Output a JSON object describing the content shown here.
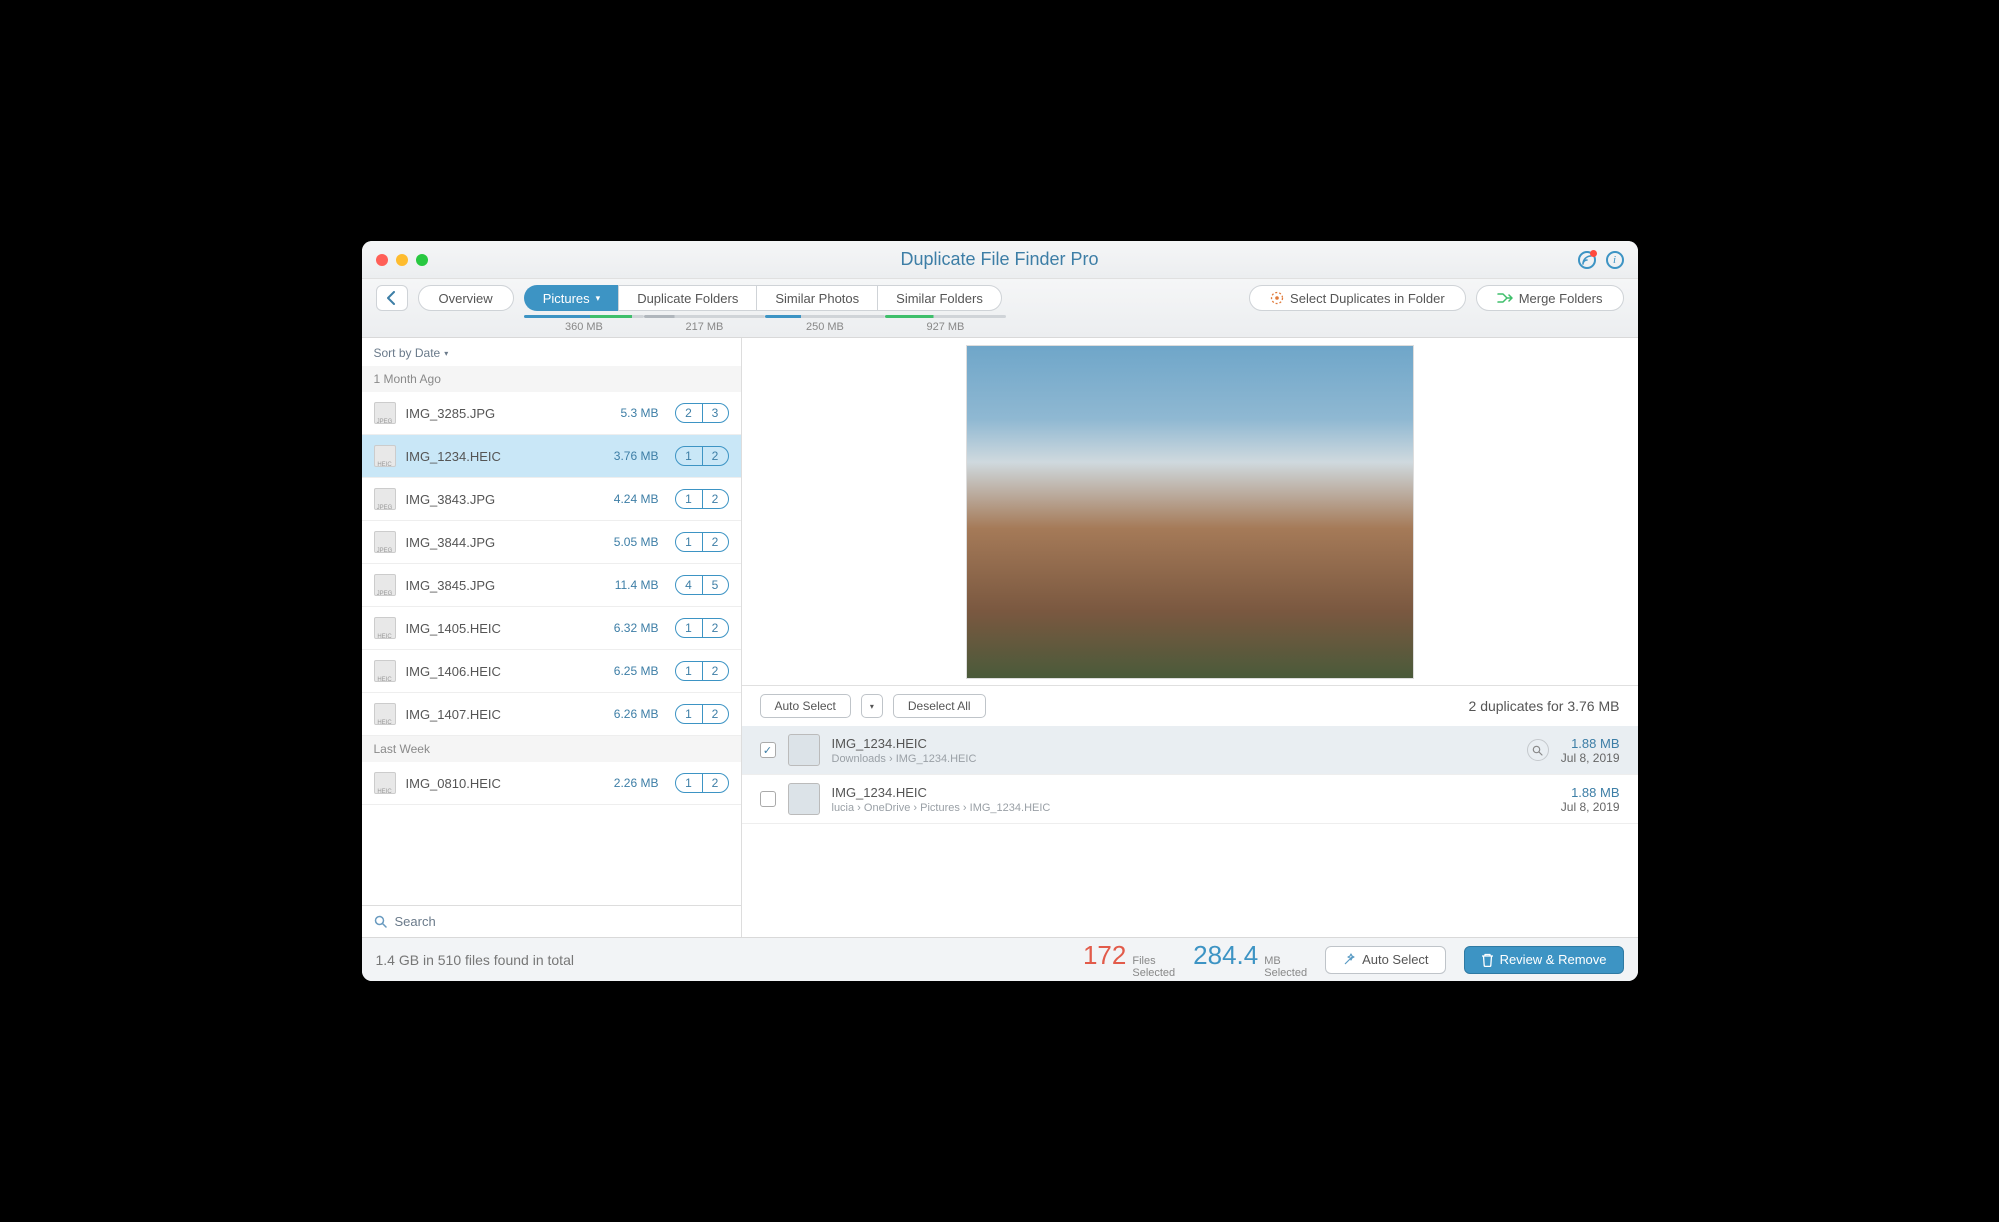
{
  "title": "Duplicate File Finder Pro",
  "toolbar": {
    "overview": "Overview",
    "tabs": [
      {
        "label": "Pictures",
        "size": "360 MB",
        "active": true,
        "bar": {
          "c1": "#3d94c4",
          "p1": 55,
          "c2": "#3fbf6b",
          "p2": 35
        }
      },
      {
        "label": "Duplicate Folders",
        "size": "217 MB",
        "active": false,
        "bar": {
          "c1": "#b0b6bc",
          "p1": 25,
          "c2": "#d0d4d8",
          "p2": 75
        }
      },
      {
        "label": "Similar Photos",
        "size": "250 MB",
        "active": false,
        "bar": {
          "c1": "#3d94c4",
          "p1": 30,
          "c2": "#d0d4d8",
          "p2": 70
        }
      },
      {
        "label": "Similar Folders",
        "size": "927 MB",
        "active": false,
        "bar": {
          "c1": "#3fbf6b",
          "p1": 40,
          "c2": "#d0d4d8",
          "p2": 60
        }
      }
    ],
    "select_in_folder": "Select Duplicates in Folder",
    "merge_folders": "Merge Folders"
  },
  "sidebar": {
    "sort_label": "Sort by Date",
    "groups": [
      {
        "header": "1 Month Ago",
        "items": [
          {
            "name": "IMG_3285.JPG",
            "size": "5.3 MB",
            "a": "2",
            "b": "3",
            "ext": "JPEG",
            "selected": false
          },
          {
            "name": "IMG_1234.HEIC",
            "size": "3.76 MB",
            "a": "1",
            "b": "2",
            "ext": "HEIC",
            "selected": true
          },
          {
            "name": "IMG_3843.JPG",
            "size": "4.24 MB",
            "a": "1",
            "b": "2",
            "ext": "JPEG",
            "selected": false
          },
          {
            "name": "IMG_3844.JPG",
            "size": "5.05 MB",
            "a": "1",
            "b": "2",
            "ext": "JPEG",
            "selected": false
          },
          {
            "name": "IMG_3845.JPG",
            "size": "11.4 MB",
            "a": "4",
            "b": "5",
            "ext": "JPEG",
            "selected": false
          },
          {
            "name": "IMG_1405.HEIC",
            "size": "6.32 MB",
            "a": "1",
            "b": "2",
            "ext": "HEIC",
            "selected": false
          },
          {
            "name": "IMG_1406.HEIC",
            "size": "6.25 MB",
            "a": "1",
            "b": "2",
            "ext": "HEIC",
            "selected": false
          },
          {
            "name": "IMG_1407.HEIC",
            "size": "6.26 MB",
            "a": "1",
            "b": "2",
            "ext": "HEIC",
            "selected": false
          }
        ]
      },
      {
        "header": "Last Week",
        "items": [
          {
            "name": "IMG_0810.HEIC",
            "size": "2.26 MB",
            "a": "1",
            "b": "2",
            "ext": "HEIC",
            "selected": false
          }
        ]
      }
    ],
    "search_placeholder": "Search"
  },
  "detail": {
    "auto_select": "Auto Select",
    "deselect_all": "Deselect All",
    "summary": "2 duplicates for 3.76 MB",
    "duplicates": [
      {
        "checked": true,
        "name": "IMG_1234.HEIC",
        "path": "Downloads  ›  IMG_1234.HEIC",
        "size": "1.88 MB",
        "date": "Jul 8, 2019"
      },
      {
        "checked": false,
        "name": "IMG_1234.HEIC",
        "path": "lucia  ›  OneDrive  ›  Pictures  ›  IMG_1234.HEIC",
        "size": "1.88 MB",
        "date": "Jul 8, 2019"
      }
    ]
  },
  "footer": {
    "summary": "1.4 GB in 510 files found in total",
    "files_num": "172",
    "files_l1": "Files",
    "files_l2": "Selected",
    "mb_num": "284.4",
    "mb_l1": "MB",
    "mb_l2": "Selected",
    "auto_select": "Auto Select",
    "review": "Review & Remove"
  }
}
